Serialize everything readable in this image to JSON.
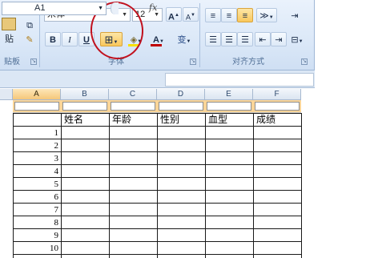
{
  "ribbon": {
    "clipboard": {
      "cut_icon": "scissors-icon",
      "copy_icon": "copy-icon",
      "paste_partial_label": "贴",
      "format_painter_icon": "format-painter-icon",
      "group_label_partial": "贴板"
    },
    "font": {
      "font_name": "宋体",
      "font_size": "12",
      "grow_label": "A",
      "shrink_label": "A",
      "bold": "B",
      "italic": "I",
      "underline": "U",
      "borders_icon": "borders-icon",
      "fill_icon": "fill-color-icon",
      "font_color_label": "A",
      "phonetic_label": "变",
      "group_label": "字体"
    },
    "alignment": {
      "wrap_icon": "wrap-text-icon",
      "merge_icon": "merge-cells-icon",
      "group_label": "对齐方式"
    },
    "colors": {
      "highlight": "#f0c040",
      "font_color": "#c00000",
      "circle": "#c1121f"
    }
  },
  "formula_bar": {
    "name_box": "A1",
    "fx_label": "fx"
  },
  "sheet": {
    "columns": [
      "A",
      "B",
      "C",
      "D",
      "E",
      "F"
    ],
    "selected_column": "A",
    "header_row": [
      "姓名",
      "年龄",
      "性别",
      "血型",
      "成绩"
    ],
    "row_numbers": [
      "1",
      "2",
      "3",
      "4",
      "5",
      "6",
      "7",
      "8",
      "9",
      "10"
    ]
  }
}
